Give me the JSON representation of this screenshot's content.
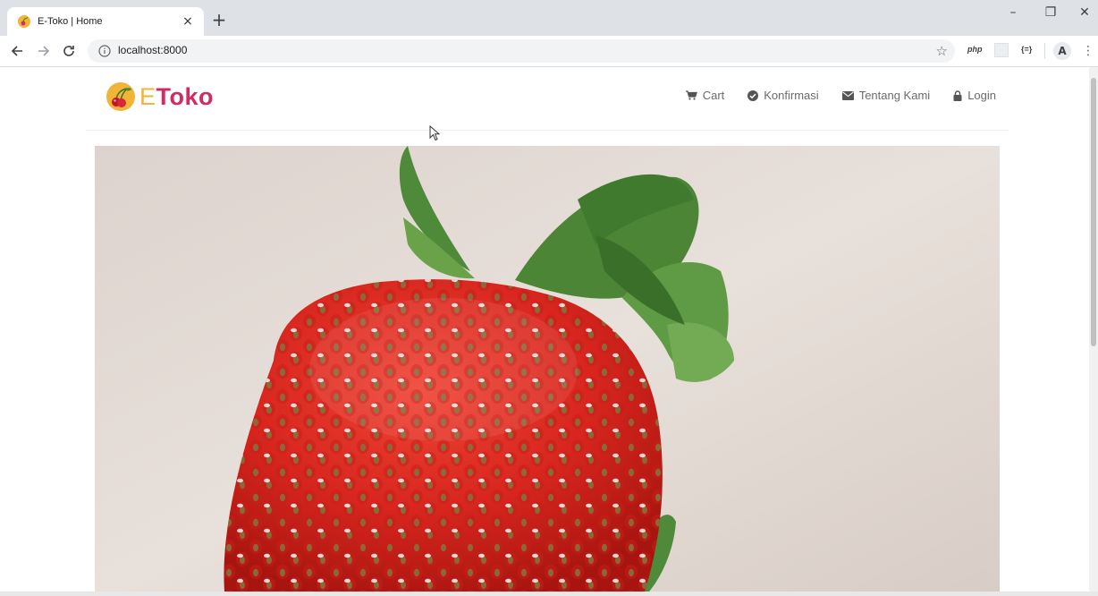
{
  "browser": {
    "tab_title": "E-Toko | Home",
    "tab_close": "×",
    "new_tab": "+",
    "address": "localhost:8000",
    "extensions": {
      "php": "php",
      "json": "{=}"
    },
    "profile_initial": "A",
    "window_controls": {
      "minimize": "–",
      "restore": "❐",
      "close": "✕"
    }
  },
  "site": {
    "logo": {
      "e": "E",
      "rest": "Toko"
    },
    "nav": [
      {
        "label": "Cart",
        "icon": "cart-icon"
      },
      {
        "label": "Konfirmasi",
        "icon": "check-circle-icon"
      },
      {
        "label": "Tentang Kami",
        "icon": "envelope-icon"
      },
      {
        "label": "Login",
        "icon": "lock-icon"
      }
    ]
  },
  "colors": {
    "brand_pink": "#d02b63",
    "brand_yellow": "#f2b437",
    "nav_text": "#6b6b6b"
  }
}
